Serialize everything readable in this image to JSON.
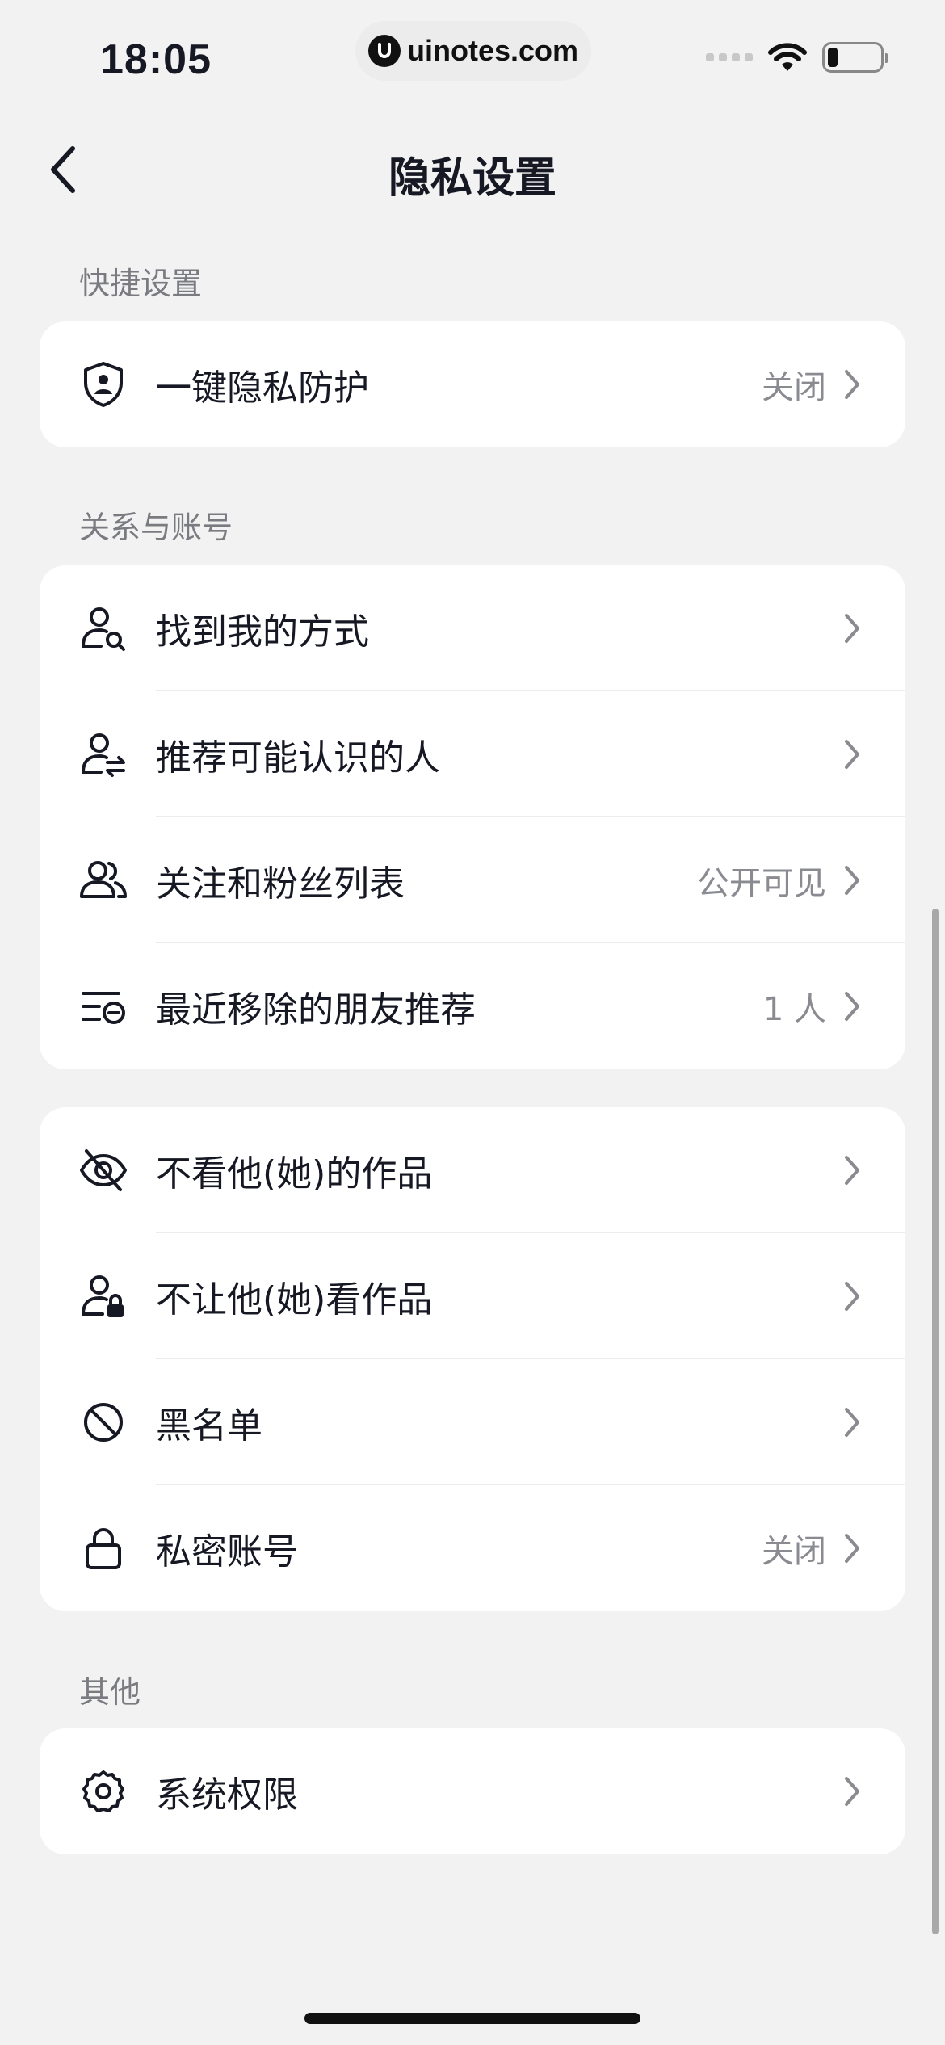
{
  "status_bar": {
    "time": "18:05",
    "url": "uinotes.com"
  },
  "nav": {
    "title": "隐私设置"
  },
  "sections": {
    "quick": {
      "header": "快捷设置",
      "items": [
        {
          "label": "一键隐私防护",
          "value": "关闭",
          "icon": "shield-person-icon"
        }
      ]
    },
    "relations": {
      "header": "关系与账号",
      "items": [
        {
          "label": "找到我的方式",
          "value": "",
          "icon": "person-search-icon"
        },
        {
          "label": "推荐可能认识的人",
          "value": "",
          "icon": "person-swap-icon"
        },
        {
          "label": "关注和粉丝列表",
          "value": "公开可见",
          "icon": "people-icon"
        },
        {
          "label": "最近移除的朋友推荐",
          "value": "1 人",
          "icon": "list-remove-icon"
        }
      ]
    },
    "visibility": {
      "items": [
        {
          "label": "不看他(她)的作品",
          "value": "",
          "icon": "eye-off-icon"
        },
        {
          "label": "不让他(她)看作品",
          "value": "",
          "icon": "person-lock-icon"
        },
        {
          "label": "黑名单",
          "value": "",
          "icon": "block-icon"
        },
        {
          "label": "私密账号",
          "value": "关闭",
          "icon": "lock-icon"
        }
      ]
    },
    "other": {
      "header": "其他",
      "items": [
        {
          "label": "系统权限",
          "value": "",
          "icon": "gear-icon"
        }
      ]
    }
  }
}
